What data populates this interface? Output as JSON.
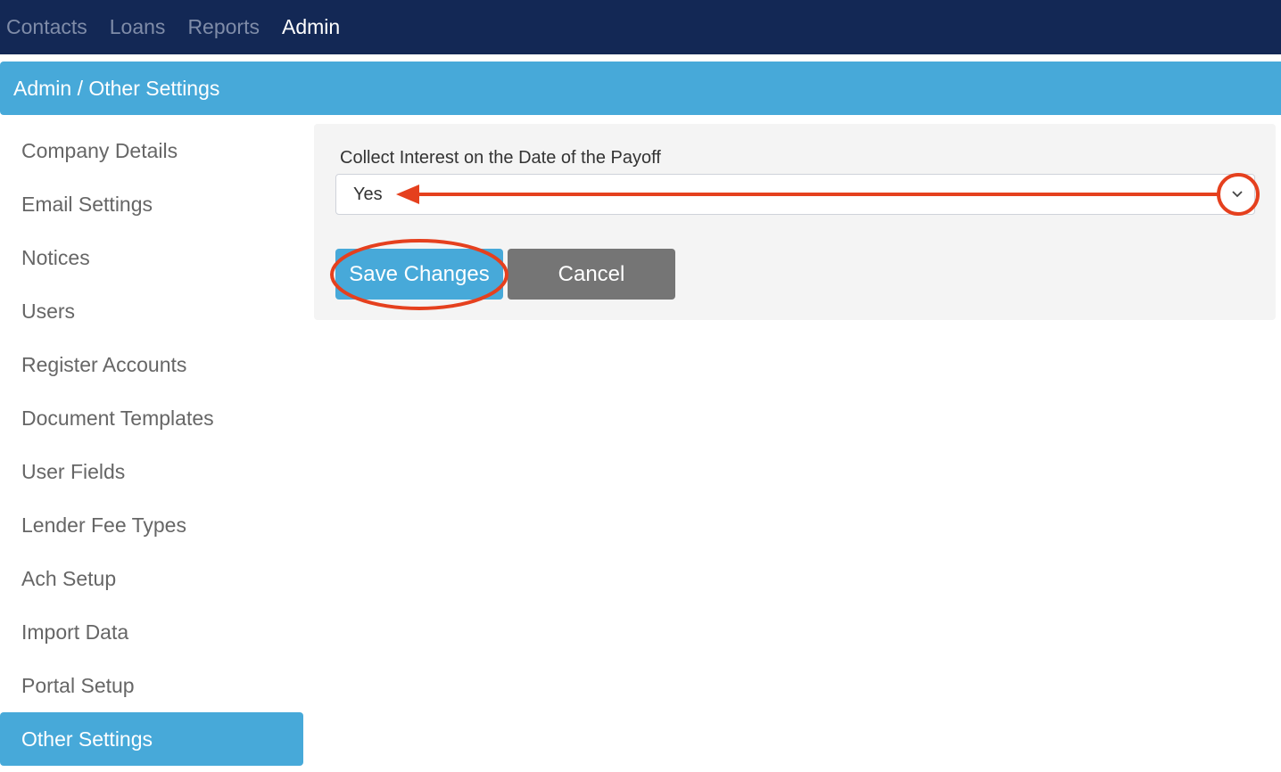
{
  "topnav": {
    "items": [
      {
        "label": "Contacts",
        "active": false
      },
      {
        "label": "Loans",
        "active": false
      },
      {
        "label": "Reports",
        "active": false
      },
      {
        "label": "Admin",
        "active": true
      }
    ]
  },
  "breadcrumb": {
    "text": "Admin / Other Settings"
  },
  "sidebar": {
    "items": [
      {
        "label": "Company Details"
      },
      {
        "label": "Email Settings"
      },
      {
        "label": "Notices"
      },
      {
        "label": "Users"
      },
      {
        "label": "Register Accounts"
      },
      {
        "label": "Document Templates"
      },
      {
        "label": "User Fields"
      },
      {
        "label": "Lender Fee Types"
      },
      {
        "label": "Ach Setup"
      },
      {
        "label": "Import Data"
      },
      {
        "label": "Portal Setup"
      },
      {
        "label": "Other Settings",
        "active": true
      }
    ]
  },
  "form": {
    "field_label": "Collect Interest on the Date of the Payoff",
    "select_value": "Yes",
    "chevron_icon": "chevron-down-icon",
    "save_label": "Save Changes",
    "cancel_label": "Cancel"
  },
  "colors": {
    "nav_bg": "#132855",
    "accent": "#47a9d9",
    "cancel": "#757575",
    "annotation": "#e5401e"
  }
}
